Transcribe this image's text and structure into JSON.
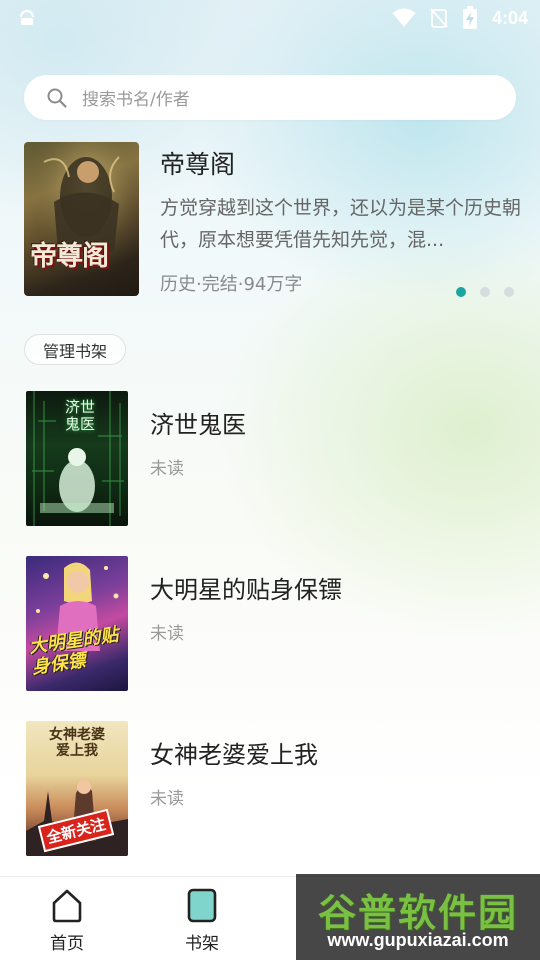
{
  "status_bar": {
    "time": "4:04",
    "icons": [
      "android-icon",
      "wifi-icon",
      "no-signal-icon",
      "battery-charging-icon"
    ]
  },
  "search": {
    "placeholder": "搜索书名/作者"
  },
  "featured": {
    "title": "帝尊阁",
    "description": "方觉穿越到这个世界，还以为是某个历史朝代，原本想要凭借先知先觉，混...",
    "meta": "历史·完结·94万字",
    "cover_title": "帝尊阁",
    "carousel_total": 3,
    "carousel_active": 1
  },
  "shelf": {
    "manage_label": "管理书架"
  },
  "books": [
    {
      "title": "济世鬼医",
      "status": "未读",
      "cover_text": "济世鬼医"
    },
    {
      "title": "大明星的贴身保镖",
      "status": "未读",
      "cover_text": "大明星的贴身保镖"
    },
    {
      "title": "女神老婆爱上我",
      "status": "未读",
      "cover_text": "女神老婆爱上我",
      "cover_badge": "全新关注"
    }
  ],
  "bottom_nav": {
    "items": [
      {
        "label": "首页",
        "icon": "home-icon"
      },
      {
        "label": "书架",
        "icon": "bookshelf-icon"
      }
    ]
  },
  "watermark": {
    "title": "谷普软件园",
    "url": "www.gupuxiazai.com"
  },
  "colors": {
    "accent": "#1aa5a0",
    "bookshelf_icon_fill": "#7fd4cc"
  }
}
